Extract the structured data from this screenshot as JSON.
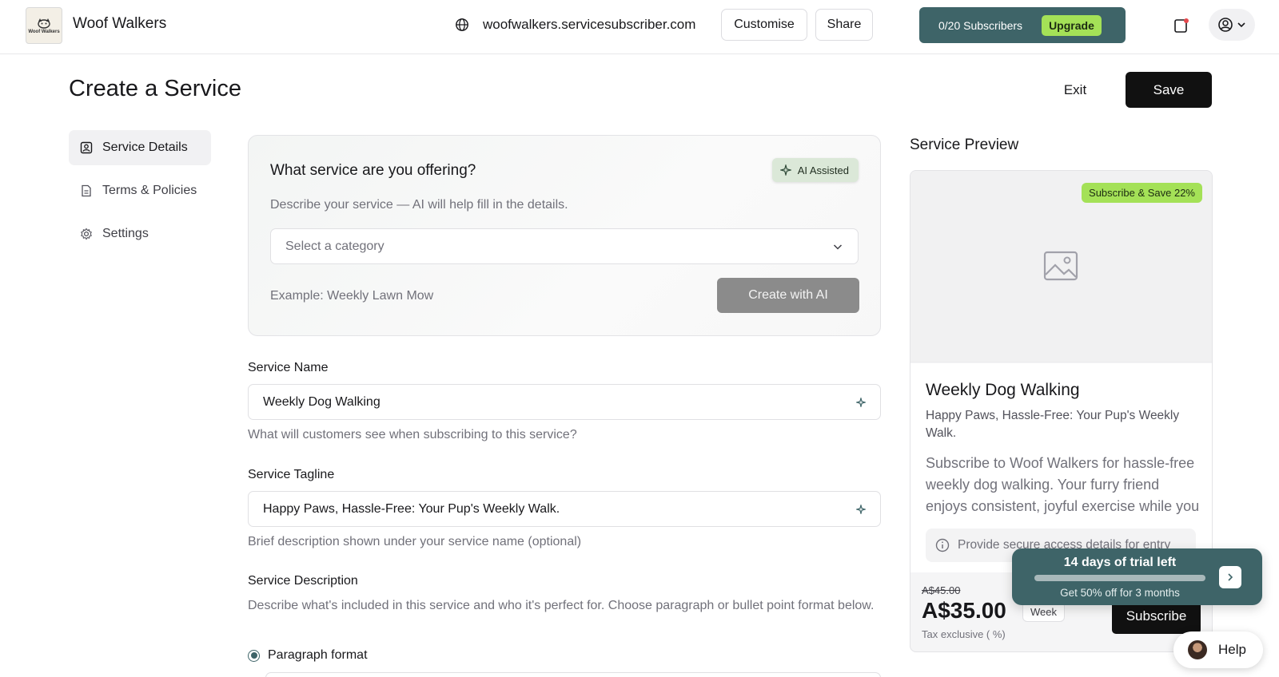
{
  "header": {
    "logo_text": "Woof Walkers",
    "brand": "Woof Walkers",
    "domain": "woofwalkers.servicesubscriber.com",
    "customise_label": "Customise",
    "share_label": "Share",
    "subscribers_label": "0/20 Subscribers",
    "upgrade_label": "Upgrade"
  },
  "page": {
    "title": "Create a Service",
    "exit_label": "Exit",
    "save_label": "Save"
  },
  "nav": {
    "items": [
      {
        "label": "Service Details",
        "icon": "contact-card-icon",
        "active": true
      },
      {
        "label": "Terms & Policies",
        "icon": "document-icon",
        "active": false
      },
      {
        "label": "Settings",
        "icon": "gear-icon",
        "active": false
      }
    ]
  },
  "ai_card": {
    "title": "What service are you offering?",
    "badge": "AI Assisted",
    "description": "Describe your service — AI will help fill in the details.",
    "category_placeholder": "Select a category",
    "example": "Example: Weekly Lawn Mow",
    "create_label": "Create with AI"
  },
  "form": {
    "name_label": "Service Name",
    "name_value": "Weekly Dog Walking",
    "name_hint": "What will customers see when subscribing to this service?",
    "tagline_label": "Service Tagline",
    "tagline_value": "Happy Paws, Hassle-Free: Your Pup's Weekly Walk.",
    "tagline_hint": "Brief description shown under your service name (optional)",
    "description_label": "Service Description",
    "description_hint": "Describe what's included in this service and who it's perfect for. Choose paragraph or bullet point format below.",
    "format_option": "Paragraph format",
    "format_selected": true
  },
  "preview": {
    "title": "Service Preview",
    "badge": "Subscribe & Save 22%",
    "name": "Weekly Dog Walking",
    "tagline": "Happy Paws, Hassle-Free: Your Pup's Weekly Walk.",
    "description": "Subscribe to Woof Walkers for hassle-free weekly dog walking. Your furry friend enjoys consistent, joyful exercise while you relax.",
    "access_note": "Provide secure access details for entry",
    "old_price": "A$45.00",
    "price": "A$35.00",
    "period": "Week",
    "tax": "Tax exclusive ( %)",
    "subscribe_label": "Subscribe"
  },
  "trial": {
    "title": "14 days of trial left",
    "subtitle": "Get 50% off for 3 months",
    "progress_fraction": 1.0
  },
  "help": {
    "label": "Help"
  },
  "colors": {
    "accent": "#3e6468",
    "highlight": "#a4e157",
    "primary_button": "#111111"
  }
}
